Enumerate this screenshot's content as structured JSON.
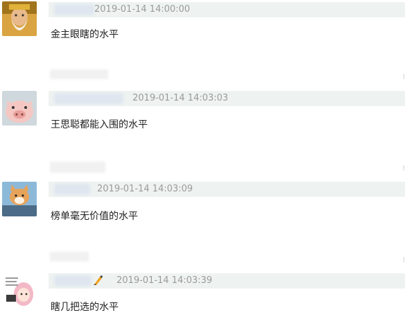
{
  "comments": [
    {
      "avatar_icon": "bearded-man-avatar-icon",
      "timestamp": "2019-01-14 14:00:00",
      "text": "金主眼瞎的水平"
    },
    {
      "avatar_icon": "pig-avatar-icon",
      "timestamp": "2019-01-14 14:03:03",
      "text": "王思聪都能入围的水平"
    },
    {
      "avatar_icon": "cat-avatar-icon",
      "avatar_caption": "你也没睡啊一起听亮吧",
      "timestamp": "2019-01-14 14:03:09",
      "text": "榜单毫无价值的水平"
    },
    {
      "avatar_icon": "girl-sticker-avatar-icon",
      "avatar_caption": "这人而不有个是就等",
      "badge_icon": "paintbrush-badge-icon",
      "timestamp": "2019-01-14 14:03:39",
      "text": "瞎几把选的水平"
    }
  ],
  "colors": {
    "meta_bar": "#eef3f1",
    "timestamp": "#9a9a9a",
    "text": "#222222"
  }
}
